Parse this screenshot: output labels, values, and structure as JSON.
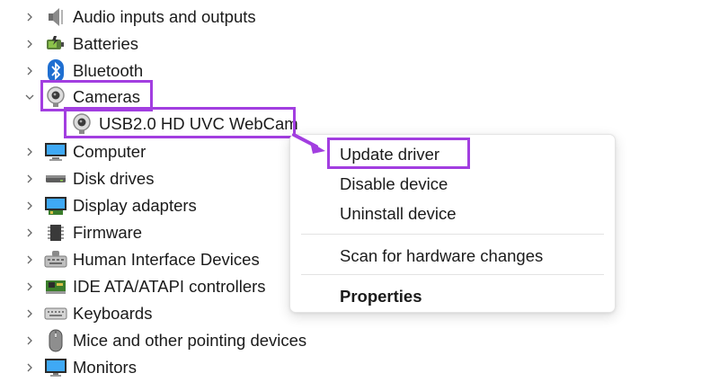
{
  "tree": {
    "items": [
      {
        "label": "Audio inputs and outputs",
        "icon": "speaker-icon",
        "expanded": false
      },
      {
        "label": "Batteries",
        "icon": "battery-icon",
        "expanded": false
      },
      {
        "label": "Bluetooth",
        "icon": "bluetooth-icon",
        "expanded": false
      },
      {
        "label": "Cameras",
        "icon": "camera-icon",
        "expanded": true
      },
      {
        "label": "USB2.0 HD UVC WebCam",
        "icon": "webcam-icon",
        "child": true
      },
      {
        "label": "Computer",
        "icon": "computer-icon",
        "expanded": false
      },
      {
        "label": "Disk drives",
        "icon": "disk-drive-icon",
        "expanded": false
      },
      {
        "label": "Display adapters",
        "icon": "display-adapter-icon",
        "expanded": false
      },
      {
        "label": "Firmware",
        "icon": "firmware-chip-icon",
        "expanded": false
      },
      {
        "label": "Human Interface Devices",
        "icon": "hid-icon",
        "expanded": false
      },
      {
        "label": "IDE ATA/ATAPI controllers",
        "icon": "ide-controller-icon",
        "expanded": false
      },
      {
        "label": "Keyboards",
        "icon": "keyboard-icon",
        "expanded": false
      },
      {
        "label": "Mice and other pointing devices",
        "icon": "mouse-icon",
        "expanded": false
      },
      {
        "label": "Monitors",
        "icon": "monitor-icon",
        "expanded": false
      }
    ]
  },
  "context_menu": {
    "update_driver": "Update driver",
    "disable_device": "Disable device",
    "uninstall_device": "Uninstall device",
    "scan_hardware": "Scan for hardware changes",
    "properties": "Properties"
  },
  "colors": {
    "highlight": "#a23ee0",
    "accent": "#0078d4"
  }
}
